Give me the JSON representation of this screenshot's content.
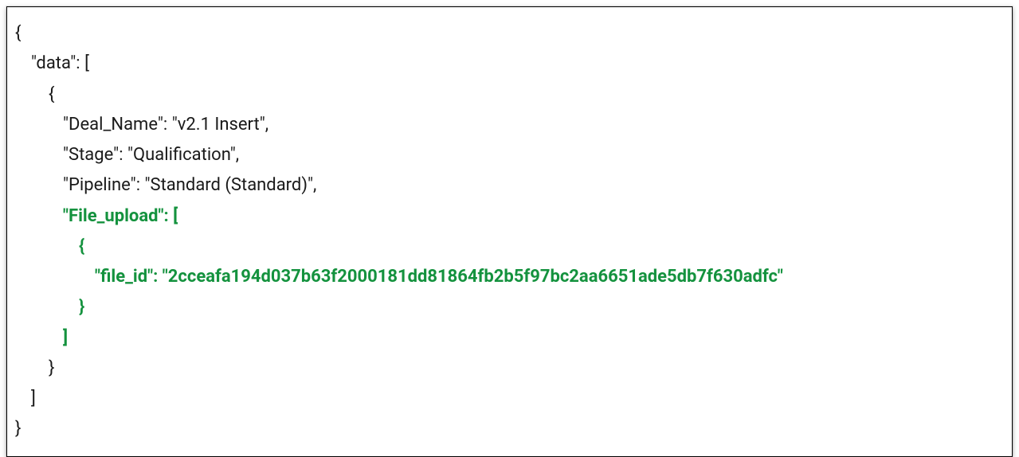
{
  "code": {
    "line1": "{",
    "line2": "\"data\": [",
    "line3": "{",
    "line4": "\"Deal_Name\": \"v2.1 Insert\",",
    "line5": "\"Stage\": \"Qualification\",",
    "line6": "\"Pipeline\": \"Standard (Standard)\",",
    "line7": "\"File_upload\": [",
    "line8": "{",
    "line9": "\"file_id\": \"2cceafa194d037b63f2000181dd81864fb2b5f97bc2aa6651ade5db7f630adfc\"",
    "line10": "}",
    "line11": "]",
    "line12": "}",
    "line13": "]",
    "line14": "}"
  },
  "json_data": {
    "data": [
      {
        "Deal_Name": "v2.1 Insert",
        "Stage": "Qualification",
        "Pipeline": "Standard (Standard)",
        "File_upload": [
          {
            "file_id": "2cceafa194d037b63f2000181dd81864fb2b5f97bc2aa6651ade5db7f630adfc"
          }
        ]
      }
    ]
  }
}
